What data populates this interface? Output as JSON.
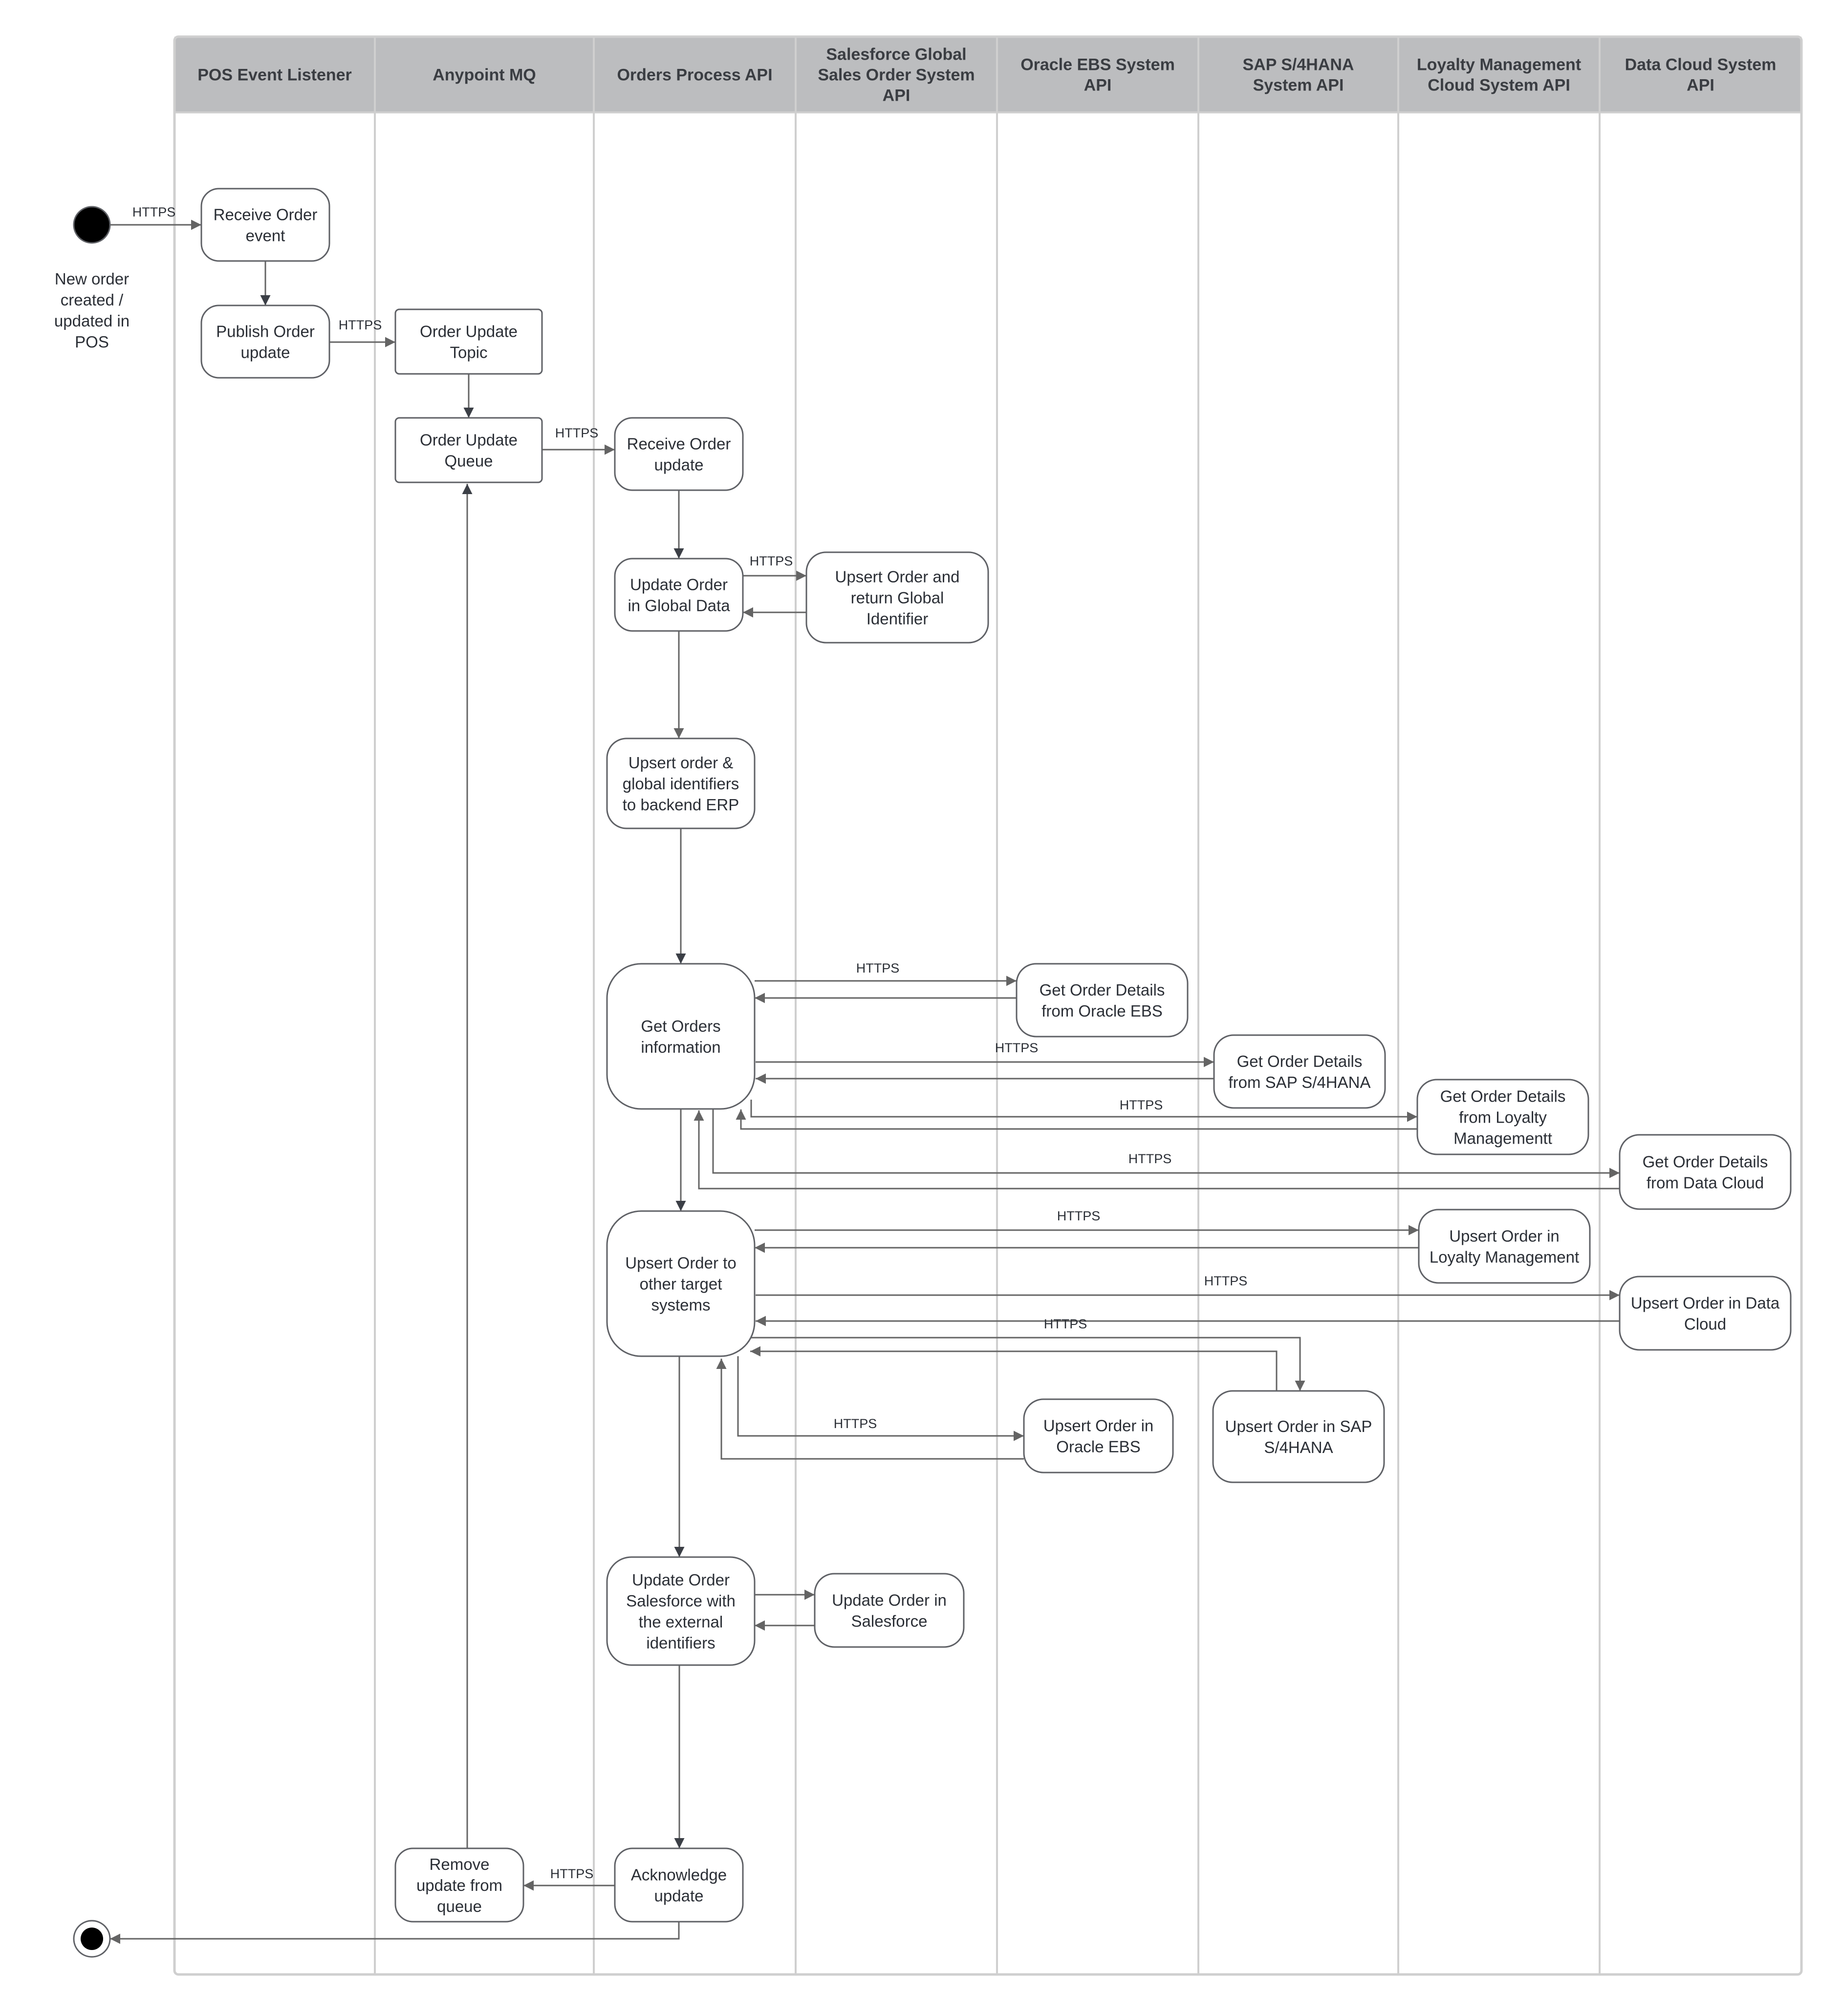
{
  "diagram": {
    "type": "swimlane-activity-diagram",
    "colors": {
      "header_bg": "#bcbdbf",
      "lane_border": "#cfcfcf",
      "node_border": "#5f6166",
      "edge": "#646464",
      "text": "#2b2f36",
      "start_end": "#000000"
    },
    "lanes": [
      {
        "id": "pos",
        "title": [
          "POS Event Listener"
        ]
      },
      {
        "id": "mq",
        "title": [
          "Anypoint MQ"
        ]
      },
      {
        "id": "opa",
        "title": [
          "Orders Process API"
        ]
      },
      {
        "id": "sfg",
        "title": [
          "Salesforce Global",
          "Sales Order System",
          "API"
        ]
      },
      {
        "id": "ebs",
        "title": [
          "Oracle EBS System",
          "API"
        ]
      },
      {
        "id": "sap",
        "title": [
          "SAP S/4HANA",
          "System API"
        ]
      },
      {
        "id": "loy",
        "title": [
          "Loyalty Management",
          "Cloud System API"
        ]
      },
      {
        "id": "dc",
        "title": [
          "Data Cloud System",
          "API"
        ]
      }
    ],
    "start_note": [
      "New order",
      "created /",
      "updated in",
      "POS"
    ],
    "nodes": [
      {
        "id": "n1",
        "lane": "pos",
        "lines": [
          "Receive Order",
          "event"
        ]
      },
      {
        "id": "n2",
        "lane": "pos",
        "lines": [
          "Publish Order",
          "update"
        ]
      },
      {
        "id": "n3",
        "lane": "mq",
        "lines": [
          "Order Update",
          "Topic"
        ]
      },
      {
        "id": "n4",
        "lane": "mq",
        "lines": [
          "Order Update",
          "Queue"
        ]
      },
      {
        "id": "n5",
        "lane": "opa",
        "lines": [
          "Receive Order",
          "update"
        ]
      },
      {
        "id": "n6",
        "lane": "opa",
        "lines": [
          "Update Order",
          "in Global Data"
        ]
      },
      {
        "id": "n7",
        "lane": "sfg",
        "lines": [
          "Upsert Order and",
          "return Global",
          "Identifier"
        ]
      },
      {
        "id": "n8",
        "lane": "opa",
        "lines": [
          "Upsert order &",
          "global identifiers",
          "to backend ERP"
        ]
      },
      {
        "id": "n9",
        "lane": "opa",
        "lines": [
          "Get Orders",
          "information"
        ]
      },
      {
        "id": "n10",
        "lane": "ebs",
        "lines": [
          "Get Order Details",
          "from Oracle EBS"
        ]
      },
      {
        "id": "n11",
        "lane": "sap",
        "lines": [
          "Get Order Details",
          "from SAP S/4HANA"
        ]
      },
      {
        "id": "n12",
        "lane": "loy",
        "lines": [
          "Get Order Details",
          "from Loyalty",
          "Managementt"
        ]
      },
      {
        "id": "n13",
        "lane": "dc",
        "lines": [
          "Get Order Details",
          "from Data Cloud"
        ]
      },
      {
        "id": "n14",
        "lane": "opa",
        "lines": [
          "Upsert Order to",
          "other target",
          "systems"
        ]
      },
      {
        "id": "n15",
        "lane": "loy",
        "lines": [
          "Upsert Order in",
          "Loyalty Management"
        ]
      },
      {
        "id": "n16",
        "lane": "dc",
        "lines": [
          "Upsert Order in Data",
          "Cloud"
        ]
      },
      {
        "id": "n17",
        "lane": "ebs",
        "lines": [
          "Upsert Order in",
          "Oracle EBS"
        ]
      },
      {
        "id": "n18",
        "lane": "sap",
        "lines": [
          "Upsert Order in SAP",
          "S/4HANA"
        ]
      },
      {
        "id": "n19",
        "lane": "opa",
        "lines": [
          "Update Order",
          "Salesforce with",
          "the external",
          "identifiers"
        ]
      },
      {
        "id": "n20",
        "lane": "sfg",
        "lines": [
          "Update Order in",
          "Salesforce"
        ]
      },
      {
        "id": "n21",
        "lane": "opa",
        "lines": [
          "Acknowledge",
          "update"
        ]
      },
      {
        "id": "n22",
        "lane": "mq",
        "lines": [
          "Remove",
          "update from",
          "queue"
        ]
      }
    ],
    "edge_labels": {
      "https": "HTTPS"
    },
    "edges": [
      {
        "from": "start",
        "to": "n1",
        "label": "HTTPS"
      },
      {
        "from": "n1",
        "to": "n2",
        "label": ""
      },
      {
        "from": "n2",
        "to": "n3",
        "label": "HTTPS"
      },
      {
        "from": "n3",
        "to": "n4",
        "label": ""
      },
      {
        "from": "n4",
        "to": "n5",
        "label": "HTTPS"
      },
      {
        "from": "n5",
        "to": "n6",
        "label": ""
      },
      {
        "from": "n6",
        "to": "n7",
        "label": "HTTPS"
      },
      {
        "from": "n7",
        "to": "n6",
        "label": ""
      },
      {
        "from": "n6",
        "to": "n8",
        "label": ""
      },
      {
        "from": "n8",
        "to": "n9",
        "label": ""
      },
      {
        "from": "n9",
        "to": "n10",
        "label": "HTTPS"
      },
      {
        "from": "n10",
        "to": "n9",
        "label": ""
      },
      {
        "from": "n9",
        "to": "n11",
        "label": "HTTPS"
      },
      {
        "from": "n11",
        "to": "n9",
        "label": ""
      },
      {
        "from": "n9",
        "to": "n12",
        "label": "HTTPS"
      },
      {
        "from": "n12",
        "to": "n9",
        "label": ""
      },
      {
        "from": "n9",
        "to": "n13",
        "label": "HTTPS"
      },
      {
        "from": "n13",
        "to": "n9",
        "label": ""
      },
      {
        "from": "n9",
        "to": "n14",
        "label": ""
      },
      {
        "from": "n14",
        "to": "n15",
        "label": "HTTPS"
      },
      {
        "from": "n15",
        "to": "n14",
        "label": ""
      },
      {
        "from": "n14",
        "to": "n16",
        "label": "HTTPS"
      },
      {
        "from": "n16",
        "to": "n14",
        "label": ""
      },
      {
        "from": "n14",
        "to": "n18",
        "label": "HTTPS"
      },
      {
        "from": "n18",
        "to": "n14",
        "label": ""
      },
      {
        "from": "n14",
        "to": "n17",
        "label": "HTTPS"
      },
      {
        "from": "n17",
        "to": "n14",
        "label": ""
      },
      {
        "from": "n14",
        "to": "n19",
        "label": ""
      },
      {
        "from": "n19",
        "to": "n20",
        "label": ""
      },
      {
        "from": "n20",
        "to": "n19",
        "label": ""
      },
      {
        "from": "n19",
        "to": "n21",
        "label": ""
      },
      {
        "from": "n21",
        "to": "n22",
        "label": "HTTPS"
      },
      {
        "from": "n22",
        "to": "n4",
        "label": ""
      },
      {
        "from": "n21",
        "to": "end",
        "label": ""
      }
    ]
  }
}
